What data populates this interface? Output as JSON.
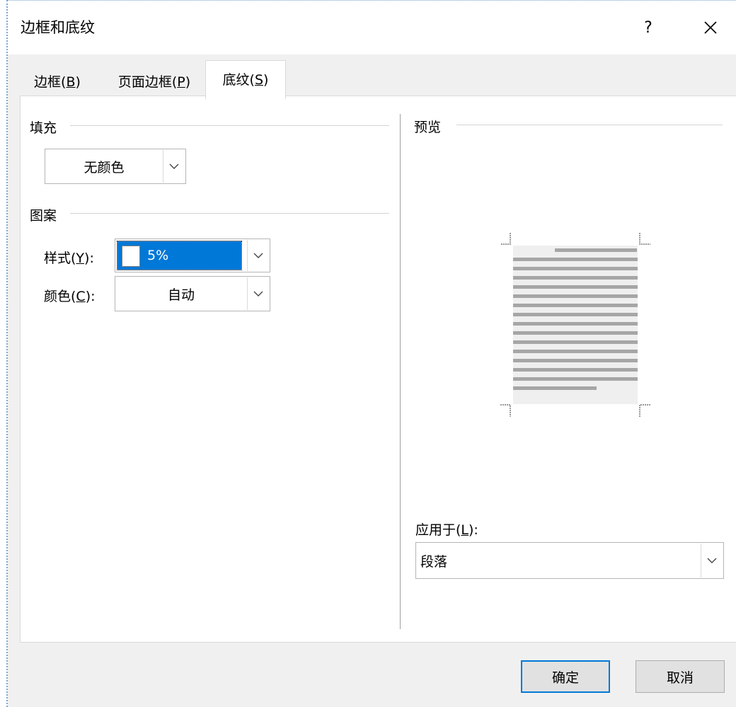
{
  "dialog": {
    "title": "边框和底纹",
    "help_label": "?"
  },
  "tabs": [
    {
      "label": "边框(",
      "key": "B",
      "suffix": ")"
    },
    {
      "label": "页面边框(",
      "key": "P",
      "suffix": ")"
    },
    {
      "label": "底纹(",
      "key": "S",
      "suffix": ")"
    }
  ],
  "fill": {
    "label": "填充",
    "value": "无颜色"
  },
  "pattern": {
    "label": "图案",
    "style_label": "样式(",
    "style_key": "Y",
    "style_suffix": "):",
    "style_value": "5%",
    "color_label": "颜色(",
    "color_key": "C",
    "color_suffix": "):",
    "color_value": "自动"
  },
  "preview": {
    "label": "预览"
  },
  "apply": {
    "label": "应用于(",
    "key": "L",
    "suffix": "):",
    "value": "段落"
  },
  "buttons": {
    "ok": "确定",
    "cancel": "取消"
  },
  "colors": {
    "accent": "#0078d7",
    "dialog_bg": "#f0f0f0",
    "preview_text_lines": "#a6a6a6"
  }
}
